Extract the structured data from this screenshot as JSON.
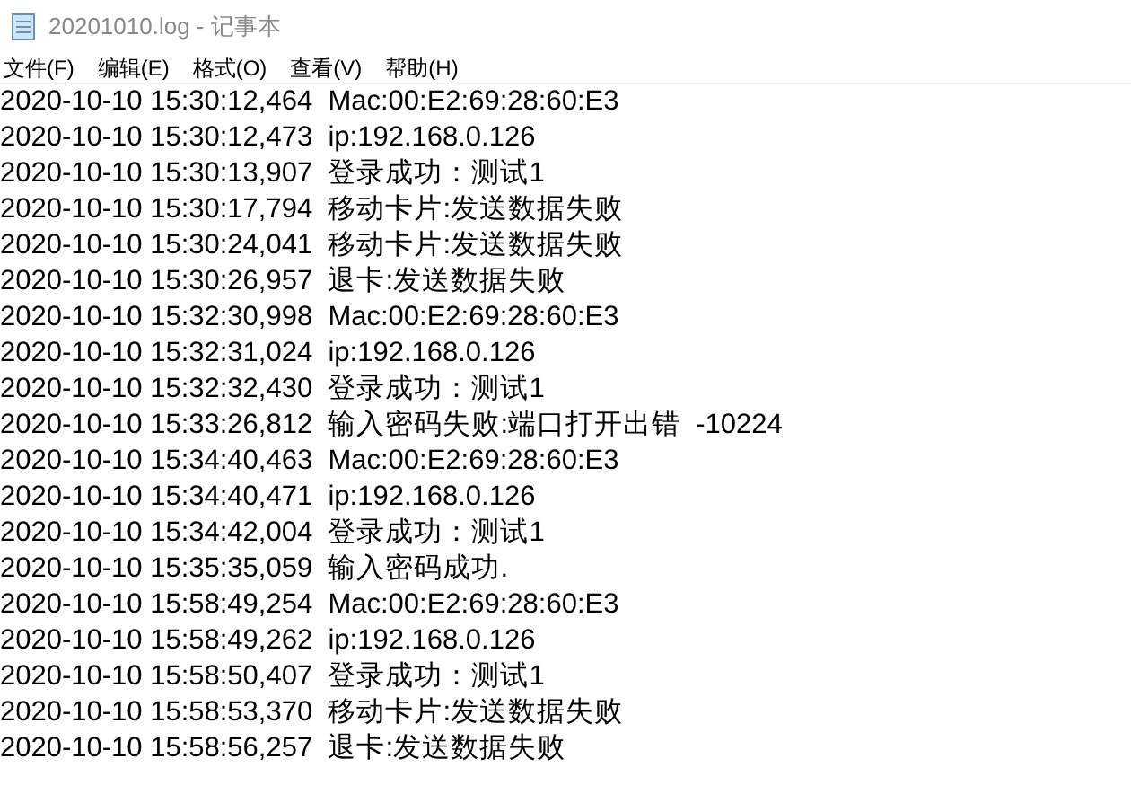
{
  "window": {
    "title": "20201010.log - 记事本"
  },
  "menu": [
    "文件(F)",
    "编辑(E)",
    "格式(O)",
    "查看(V)",
    "帮助(H)"
  ],
  "lines": [
    "2020-10-10 15:30:12,464  Mac:00:E2:69:28:60:E3",
    "2020-10-10 15:30:12,473  ip:192.168.0.126",
    "2020-10-10 15:30:13,907  登录成功：测试1",
    "2020-10-10 15:30:17,794  移动卡片:发送数据失败",
    "2020-10-10 15:30:24,041  移动卡片:发送数据失败",
    "2020-10-10 15:30:26,957  退卡:发送数据失败",
    "2020-10-10 15:32:30,998  Mac:00:E2:69:28:60:E3",
    "2020-10-10 15:32:31,024  ip:192.168.0.126",
    "2020-10-10 15:32:32,430  登录成功：测试1",
    "2020-10-10 15:33:26,812  输入密码失败:端口打开出错  -10224",
    "2020-10-10 15:34:40,463  Mac:00:E2:69:28:60:E3",
    "2020-10-10 15:34:40,471  ip:192.168.0.126",
    "2020-10-10 15:34:42,004  登录成功：测试1",
    "2020-10-10 15:35:35,059  输入密码成功.",
    "2020-10-10 15:58:49,254  Mac:00:E2:69:28:60:E3",
    "2020-10-10 15:58:49,262  ip:192.168.0.126",
    "2020-10-10 15:58:50,407  登录成功：测试1",
    "2020-10-10 15:58:53,370  移动卡片:发送数据失败",
    "2020-10-10 15:58:56,257  退卡:发送数据失败"
  ]
}
